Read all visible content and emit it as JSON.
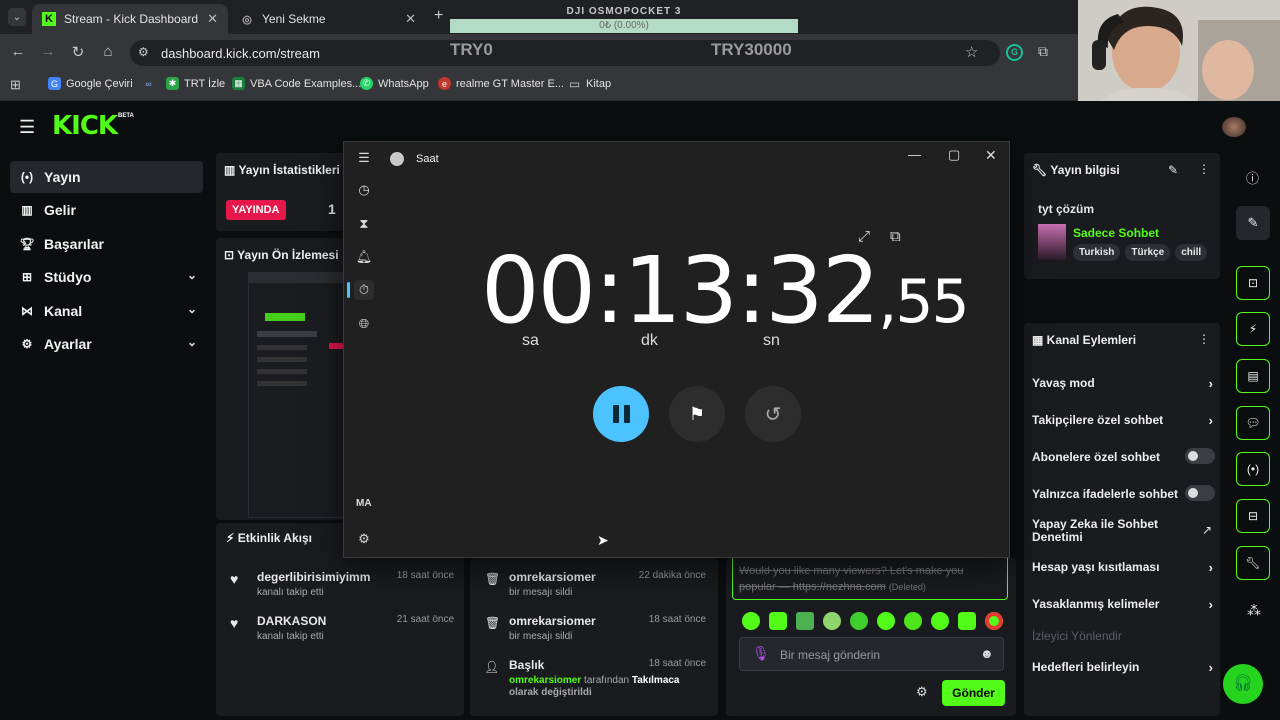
{
  "browser": {
    "tabs": [
      {
        "title": "Stream - Kick Dashboard",
        "active": true
      },
      {
        "title": "Yeni Sekme",
        "active": false
      }
    ],
    "url": "dashboard.kick.com/stream",
    "bookmarks": [
      "Google Çeviri",
      "TRT İzle",
      "VBA Code Examples...",
      "WhatsApp",
      "realme GT Master E...",
      "Kitap"
    ]
  },
  "overlay": {
    "device": "DJI OSMOPOCKET 3",
    "progress_text": "0₺ (0.00%)",
    "progress": 0,
    "min_label": "TRY0",
    "max_label": "TRY30000"
  },
  "kick": {
    "logo": "KICK",
    "beta": "BETA",
    "sidebar": [
      {
        "label": "Yayın",
        "icon": "broadcast-icon",
        "active": true
      },
      {
        "label": "Gelir",
        "icon": "chart-icon"
      },
      {
        "label": "Başarılar",
        "icon": "trophy-icon"
      },
      {
        "label": "Stüdyo",
        "icon": "studio-icon",
        "expandable": true
      },
      {
        "label": "Kanal",
        "icon": "channel-icon",
        "expandable": true
      },
      {
        "label": "Ayarlar",
        "icon": "gear-icon",
        "expandable": true
      }
    ],
    "stats_panel": {
      "title": "Yayın İstatistikleri",
      "live_badge": "YAYINDA",
      "count": "1"
    },
    "preview_panel": {
      "title": "Yayın Ön İzlemesi"
    },
    "activity_panel": {
      "title": "Etkinlik Akışı",
      "items": [
        {
          "name": "degerlibirisimiyimm",
          "sub": "kanalı takip etti",
          "time": "18 saat önce"
        },
        {
          "name": "DARKASON",
          "sub": "kanalı takip etti",
          "time": "21 saat önce"
        }
      ]
    },
    "moderation_items": [
      {
        "name": "omrekarsiomer",
        "sub": "bir mesajı sildi",
        "time": "22 dakika önce"
      },
      {
        "name": "omrekarsiomer",
        "sub": "bir mesajı sildi",
        "time": "18 saat önce"
      },
      {
        "name": "Başlık",
        "user": "omrekarsiomer",
        "mid": "tarafından",
        "field": "Takılmaca",
        "sub": "olarak değiştirildi",
        "time": "18 saat önce"
      }
    ],
    "chat": {
      "deleted_message": "Would you like many viewers? Let's make you popular — https://nezhna.com",
      "deleted_tag": "(Deleted)",
      "input_placeholder": "Bir mesaj gönderin",
      "send_label": "Gönder"
    },
    "stream_info": {
      "title": "Yayın bilgisi",
      "stream_title": "tyt çözüm",
      "category": "Sadece Sohbet",
      "tags": [
        "Turkish",
        "Türkçe",
        "chill"
      ]
    },
    "channel_actions": {
      "title": "Kanal Eylemleri",
      "items": [
        {
          "label": "Yavaş mod",
          "type": "arrow"
        },
        {
          "label": "Takipçilere özel sohbet",
          "type": "arrow"
        },
        {
          "label": "Abonelere özel sohbet",
          "type": "toggle"
        },
        {
          "label": "Yalnızca ifadelerle sohbet",
          "type": "toggle"
        },
        {
          "label": "Yapay Zeka ile Sohbet Denetimi",
          "type": "external"
        },
        {
          "label": "Hesap yaşı kısıtlaması",
          "type": "arrow"
        },
        {
          "label": "Yasaklanmış kelimeler",
          "type": "arrow"
        },
        {
          "label": "İzleyici Yönlendir",
          "type": "disabled"
        },
        {
          "label": "Hedefleri belirleyin",
          "type": "arrow"
        }
      ]
    }
  },
  "clock": {
    "app_title": "Saat",
    "hours": "00",
    "minutes": "13",
    "seconds": "32",
    "hundredths": "55",
    "unit_h": "sa",
    "unit_m": "dk",
    "unit_s": "sn",
    "user_initials": "MA"
  }
}
